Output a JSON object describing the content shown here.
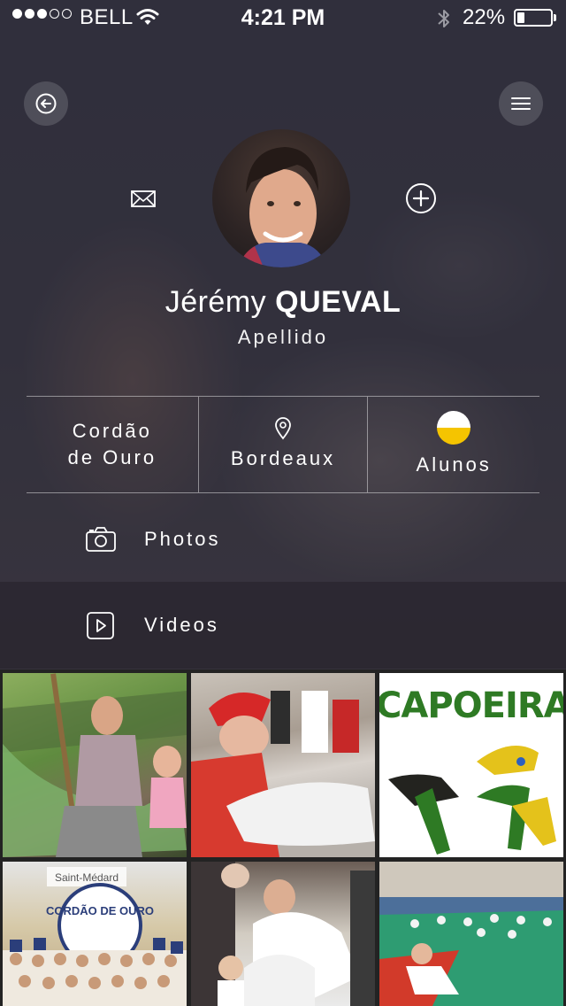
{
  "status_bar": {
    "carrier": "BELL",
    "time": "4:21 PM",
    "battery_percent": "22%",
    "battery_level": 0.22,
    "signal_strength": 3,
    "signal_max": 5
  },
  "header": {
    "back_icon": "back-arrow-circle-icon",
    "menu_icon": "hamburger-menu-icon"
  },
  "profile": {
    "first_name": "Jérémy",
    "last_name": "QUEVAL",
    "subtitle": "Apellido",
    "message_icon": "envelope-icon",
    "add_icon": "plus-circle-icon"
  },
  "stats": {
    "group": "Cordão de Ouro",
    "location": "Bordeaux",
    "level_label": "Alunos",
    "level_colors": [
      "#ffffff",
      "#f5c400"
    ]
  },
  "media_menu": [
    {
      "label": "Photos",
      "icon": "camera-icon"
    },
    {
      "label": "Videos",
      "icon": "play-icon"
    }
  ],
  "gallery": {
    "capoeira_text": "CAPOEIRA",
    "banner_text": "Saint-Médard",
    "banner_logo_text": "CORDÃO DE OURO"
  },
  "colors": {
    "accent_yellow": "#f5c400",
    "overlay": "#2a2a33"
  }
}
